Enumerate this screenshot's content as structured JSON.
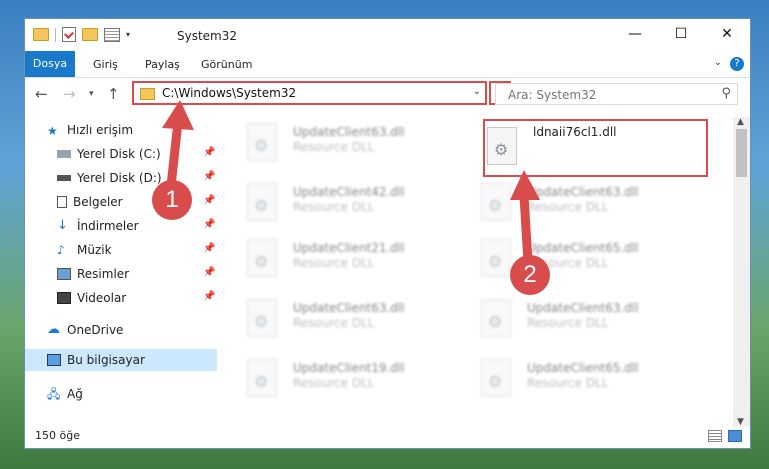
{
  "window": {
    "title": "System32",
    "min": "—",
    "max": "☐",
    "close": "✕"
  },
  "ribbon": {
    "tabs": [
      "Dosya",
      "Giriş",
      "Paylaş",
      "Görünüm"
    ],
    "help": "?"
  },
  "address": {
    "path": "C:\\Windows\\System32"
  },
  "search": {
    "placeholder": "Ara: System32"
  },
  "nav": {
    "quick_access": "Hızlı erişim",
    "items": [
      "Yerel Disk (C:)",
      "Yerel Disk (D:)",
      "Belgeler",
      "İndirmeler",
      "Müzik",
      "Resimler",
      "Videolar"
    ],
    "onedrive": "OneDrive",
    "thispc": "Bu bilgisayar",
    "network": "Ağ"
  },
  "files": {
    "target": {
      "name": "ldnaii76cl1.dll"
    },
    "left": [
      {
        "name": "UpdateClient63.dll",
        "desc": "Resource DLL"
      },
      {
        "name": "UpdateClient42.dll",
        "desc": "Resource DLL"
      },
      {
        "name": "UpdateClient21.dll",
        "desc": "Resource DLL"
      },
      {
        "name": "UpdateClient63.dll",
        "desc": "Resource DLL"
      },
      {
        "name": "UpdateClient19.dll",
        "desc": "Resource DLL"
      }
    ],
    "right": [
      {
        "name": "UpdateClient63.dll",
        "desc": "Resource DLL"
      },
      {
        "name": "UpdateClient65.dll",
        "desc": "Resource DLL"
      },
      {
        "name": "UpdateClient63.dll",
        "desc": "Resource DLL"
      },
      {
        "name": "UpdateClient65.dll",
        "desc": "Resource DLL"
      }
    ]
  },
  "status": {
    "count": "150 öğe"
  },
  "badges": {
    "one": "1",
    "two": "2"
  },
  "colors": {
    "accent": "#1979ca",
    "highlight": "#d94c4c",
    "selected": "#cce8ff"
  }
}
